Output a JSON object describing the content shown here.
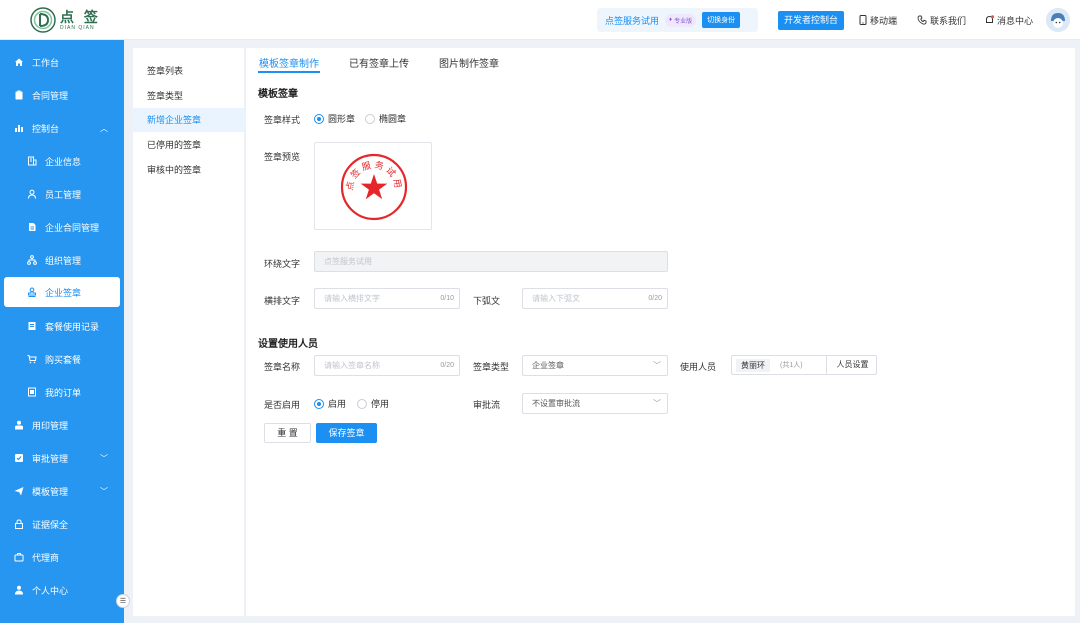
{
  "header": {
    "logo_cn": "点 签",
    "logo_en": "DIAN QIAN",
    "account_name": "点签服务试用",
    "pro_badge": "专业版",
    "switch_identity": "切换身份",
    "dev_console": "开发者控制台",
    "mobile": "移动端",
    "contact": "联系我们",
    "messages": "消息中心"
  },
  "sidebar": {
    "items": [
      {
        "label": "工作台",
        "icon": "home-icon"
      },
      {
        "label": "合同管理",
        "icon": "contract-icon"
      },
      {
        "label": "控制台",
        "icon": "chart-icon"
      },
      {
        "label": "企业信息",
        "icon": "building-icon"
      },
      {
        "label": "员工管理",
        "icon": "user-icon"
      },
      {
        "label": "企业合同管理",
        "icon": "document-icon"
      },
      {
        "label": "组织管理",
        "icon": "org-icon"
      },
      {
        "label": "企业签章",
        "icon": "stamp-icon"
      },
      {
        "label": "套餐使用记录",
        "icon": "record-icon"
      },
      {
        "label": "购买套餐",
        "icon": "cart-icon"
      },
      {
        "label": "我的订单",
        "icon": "order-icon"
      },
      {
        "label": "用印管理",
        "icon": "seal-user-icon"
      },
      {
        "label": "审批管理",
        "icon": "approve-icon"
      },
      {
        "label": "模板管理",
        "icon": "send-icon"
      },
      {
        "label": "证据保全",
        "icon": "lock-icon"
      },
      {
        "label": "代理商",
        "icon": "briefcase-icon"
      },
      {
        "label": "个人中心",
        "icon": "person-icon"
      }
    ]
  },
  "subnav": {
    "items": [
      "签章列表",
      "签章类型",
      "新增企业签章",
      "已停用的签章",
      "审核中的签章"
    ]
  },
  "tabs": [
    "模板签章制作",
    "已有签章上传",
    "图片制作签章"
  ],
  "form": {
    "section1": "模板签章",
    "style_label": "签章样式",
    "style_round": "圆形章",
    "style_oval": "椭圆章",
    "preview_label": "签章预览",
    "seal_ring_text": "点签服务试用",
    "ring_label": "环绕文字",
    "ring_value": "点签服务试用",
    "horizontal_label": "横排文字",
    "horizontal_placeholder": "请输入横排文字",
    "horizontal_count": "0/10",
    "bottom_label": "下弧文",
    "bottom_placeholder": "请输入下弧文",
    "bottom_count": "0/20",
    "section2": "设置使用人员",
    "name_label": "签章名称",
    "name_placeholder": "请输入签章名称",
    "name_count": "0/20",
    "type_label": "签章类型",
    "type_value": "企业签章",
    "users_label": "使用人员",
    "user_tag": "黄丽环",
    "user_count": "(共1人)",
    "users_btn": "人员设置",
    "enable_label": "是否启用",
    "enable_on": "启用",
    "enable_off": "停用",
    "flow_label": "审批流",
    "flow_value": "不设置审批流",
    "reset_btn": "重 置",
    "save_btn": "保存签章"
  },
  "colors": {
    "brand": "#1b8ff2",
    "sidebar": "#2796f0",
    "seal_red": "#e5262a",
    "logo_green": "#2f6f51"
  }
}
